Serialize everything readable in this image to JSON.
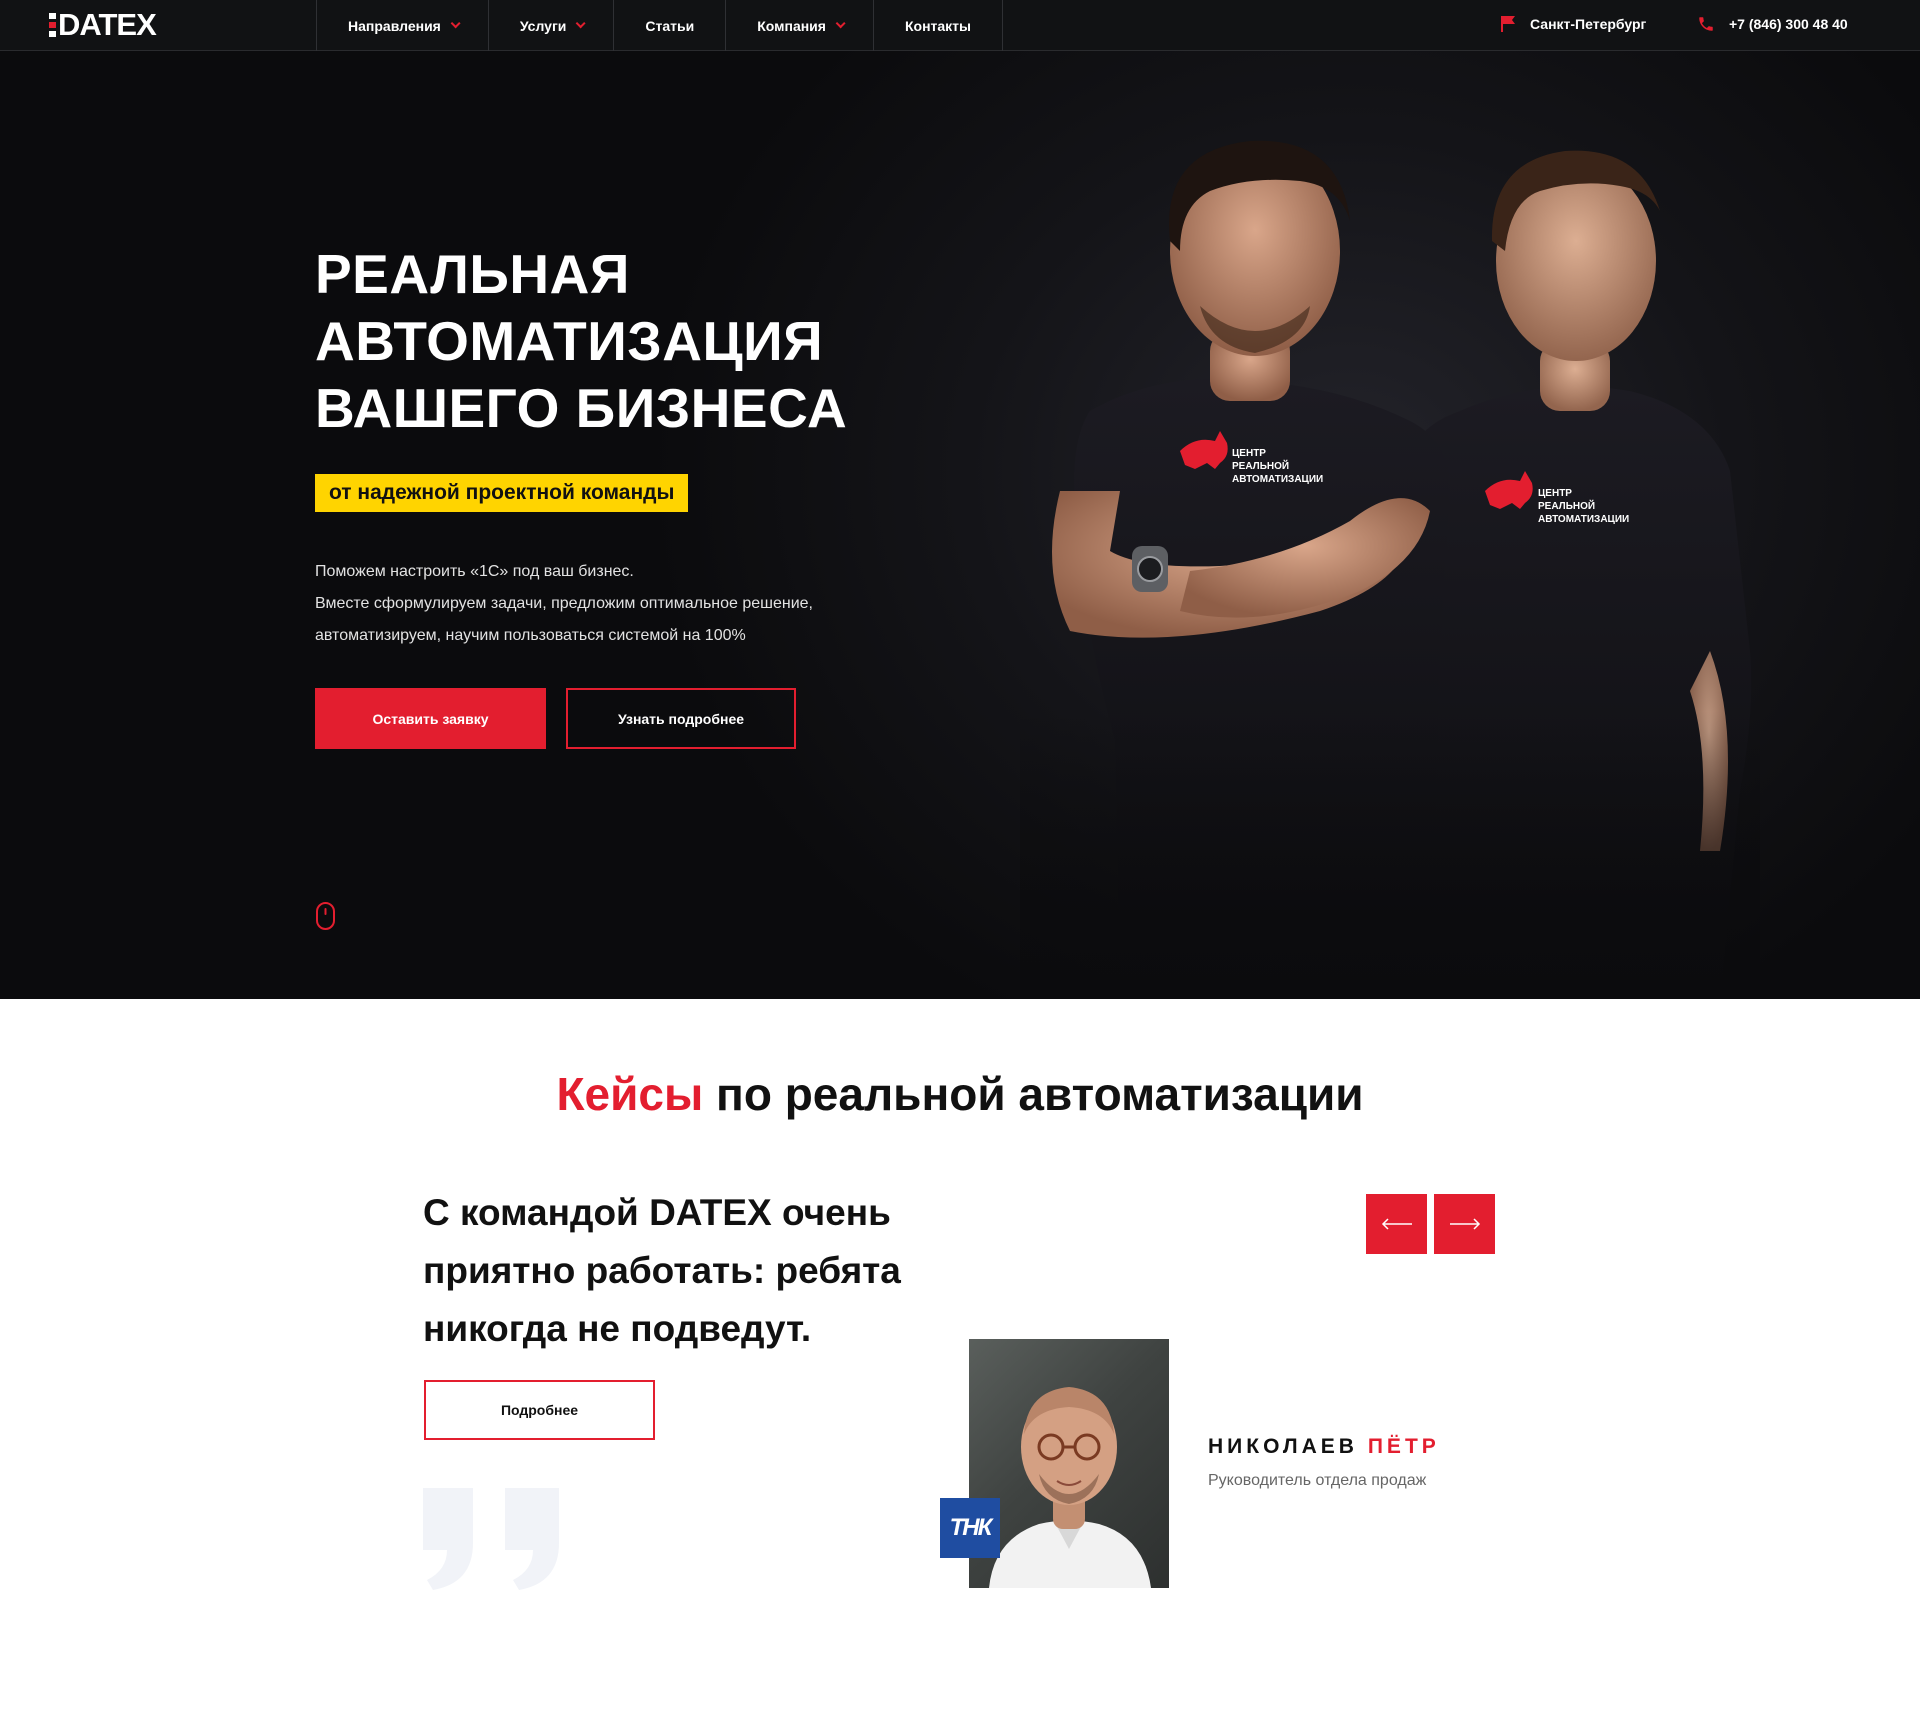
{
  "header": {
    "logo_text": "DATEX",
    "nav": [
      {
        "label": "Направления",
        "has_dropdown": true
      },
      {
        "label": "Услуги",
        "has_dropdown": true
      },
      {
        "label": "Статьи",
        "has_dropdown": false
      },
      {
        "label": "Компания",
        "has_dropdown": true
      },
      {
        "label": "Контакты",
        "has_dropdown": false
      }
    ],
    "city": "Санкт-Петербург",
    "phone": "+7 (846) 300 48 40",
    "city_icon": "flag-icon",
    "phone_icon": "phone-icon"
  },
  "hero": {
    "title_lines": [
      "РЕАЛЬНАЯ",
      "АВТОМАТИЗАЦИЯ",
      "ВАШЕГО БИЗНЕСА"
    ],
    "badge": "от надежной проектной команды",
    "description": [
      "Поможем настроить «1С» под ваш бизнес.",
      "Вместе сформулируем задачи, предложим оптимальное решение,",
      "автоматизируем, научим пользоваться системой на 100%"
    ],
    "primary_button": "Оставить заявку",
    "secondary_button": "Узнать подробнее",
    "shirt_logo_lines": [
      "ЦЕНТР",
      "РЕАЛЬНОЙ",
      "АВТОМАТИЗАЦИИ"
    ]
  },
  "cases": {
    "title_accent": "Кейсы",
    "title_rest": " по реальной автоматизации",
    "quote": "С командой DATEX очень приятно работать: ребята никогда не подведут.",
    "more_button": "Подробнее",
    "person_last_name": "НИКОЛАЕВ",
    "person_first_name": "ПЁТР",
    "person_role": "Руководитель отдела продаж",
    "company_logo_text": "ТНК"
  },
  "colors": {
    "accent": "#e31e2f",
    "badge": "#ffd400",
    "dark_bg": "#111214",
    "company_logo": "#1f4da1"
  }
}
